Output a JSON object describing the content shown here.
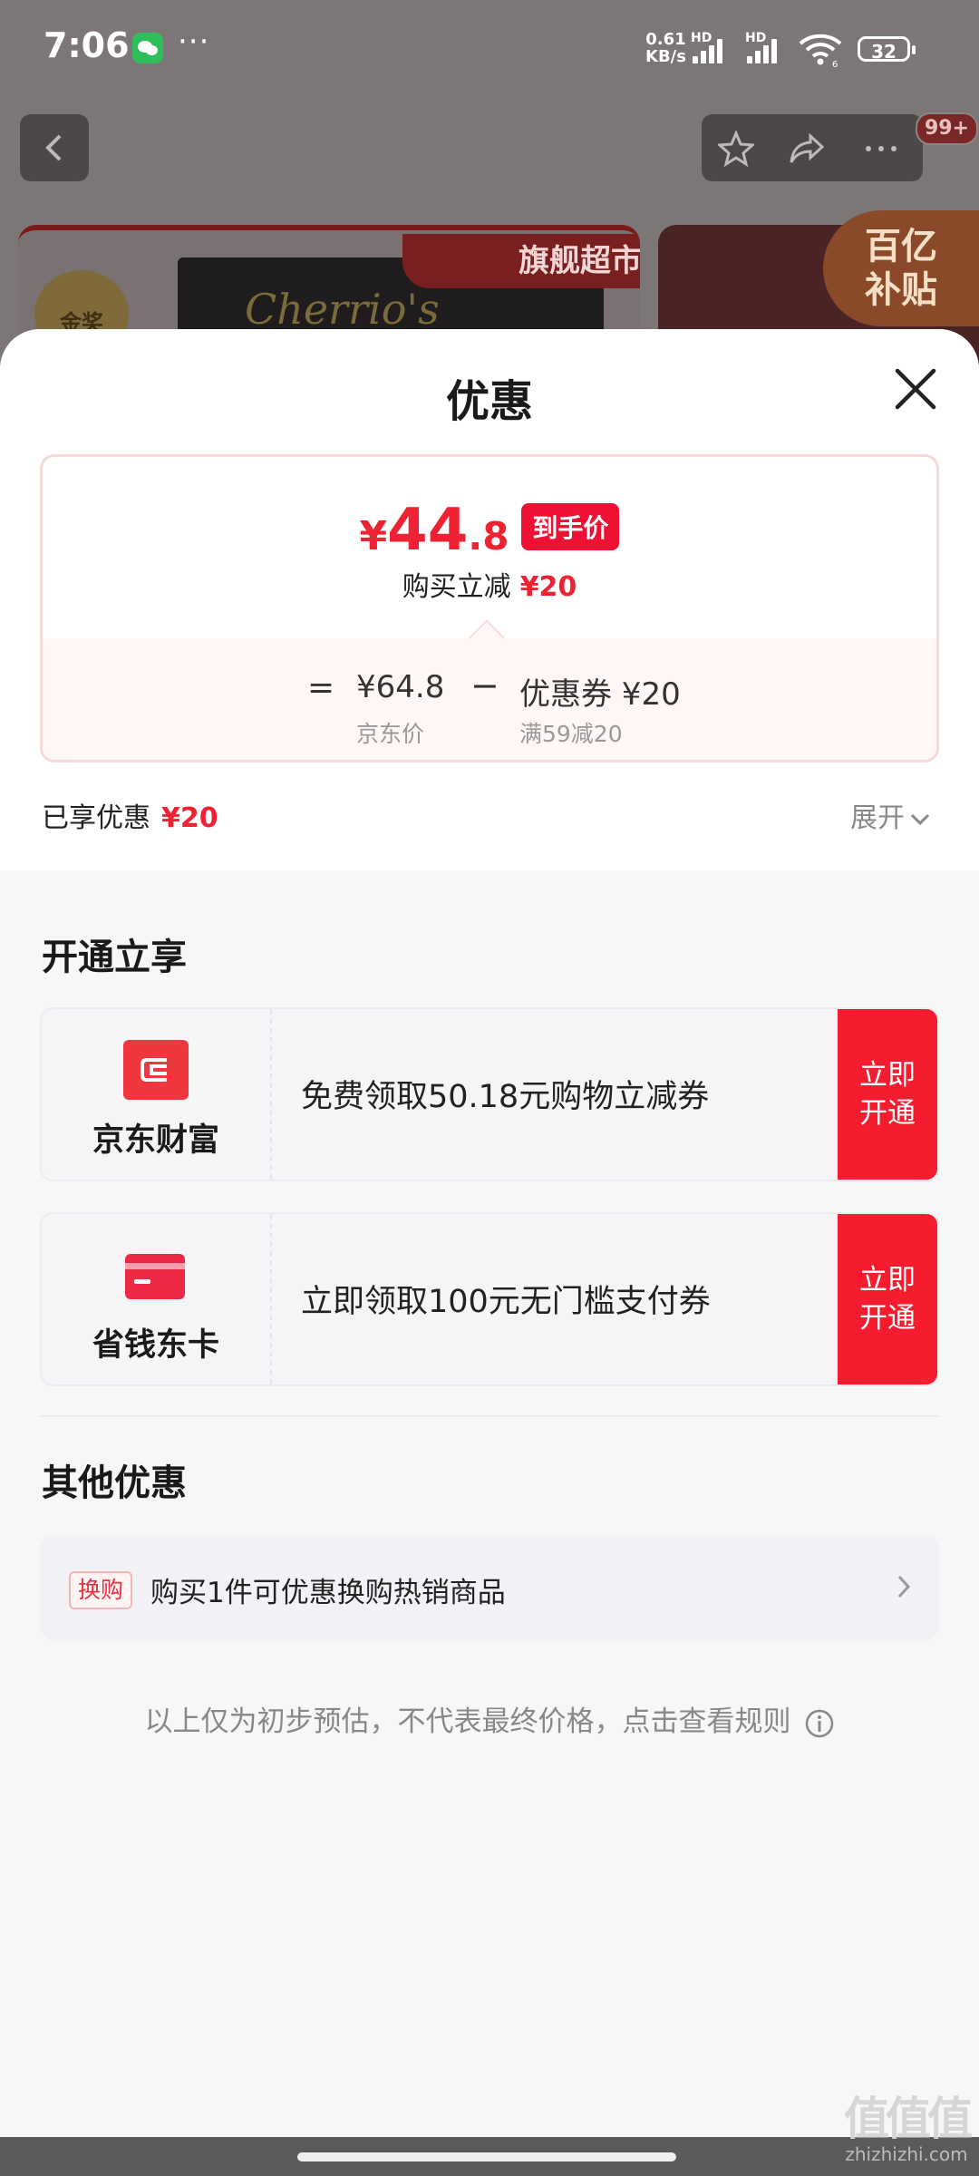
{
  "status_bar": {
    "time": "7:06",
    "dots": "···",
    "net_speed_value": "0.61",
    "net_speed_unit": "KB/s",
    "hd1": "HD",
    "hd2": "HD",
    "sim2_sub": "6",
    "battery": "32"
  },
  "background_page": {
    "badge": "99+",
    "medal_text": "金奖",
    "product_script": "Cherrio's",
    "flagship_label": "旗舰超市",
    "subsidy_badge": "百亿\n补贴"
  },
  "sheet": {
    "title": "优惠",
    "price_card": {
      "currency": "¥",
      "price_int": "44",
      "price_dec": ".8",
      "price_tag": "到手价",
      "instant_cut_label": "购买立减",
      "instant_cut_value": "¥20",
      "equals": "=",
      "jd_price": "¥64.8",
      "jd_price_label": "京东价",
      "minus": "−",
      "coupon": "优惠券 ¥20",
      "coupon_rule": "满59减20"
    },
    "enjoyed_label": "已享优惠",
    "enjoyed_value": "¥20",
    "expand_label": "展开",
    "open_section_title": "开通立享",
    "offers": [
      {
        "name": "京东财富",
        "text": "免费领取50.18元购物立减券",
        "button": "立即\n开通",
        "color": "#f03740"
      },
      {
        "name": "省钱东卡",
        "text": "立即领取100元无门槛支付券",
        "button": "立即\n开通",
        "color": "#ec2a45"
      }
    ],
    "other_section_title": "其他优惠",
    "swap": {
      "tag": "换购",
      "text": "购买1件可优惠换购热销商品"
    },
    "disclaimer": "以上仅为初步预估，不代表最终价格，点击查看规则"
  },
  "watermark": {
    "glyph": "值值值",
    "site": "zhizhizhi.com"
  }
}
